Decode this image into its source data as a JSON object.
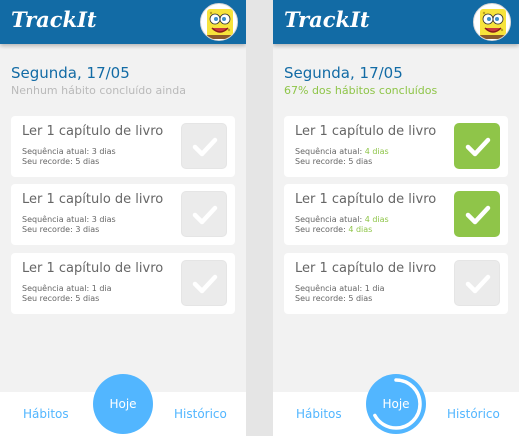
{
  "app": {
    "logo": "TrackIt",
    "avatar_icon": "spongebob-avatar"
  },
  "colors": {
    "header": "#126BA5",
    "accent": "#52B6FF",
    "done": "#8FC549",
    "pending": "#EBEBEB"
  },
  "screens": [
    {
      "date": "Segunda, 17/05",
      "subtitle": "Nenhum hábito concluído ainda",
      "progress": 0,
      "habits": [
        {
          "title": "Ler 1 capítulo de livro",
          "sequence_label": "Sequência atual:",
          "sequence_value": "3 dias",
          "record_label": "Seu recorde:",
          "record_value": "5 dias",
          "done": false
        },
        {
          "title": "Ler 1 capítulo de livro",
          "sequence_label": "Sequência atual:",
          "sequence_value": "3 dias",
          "record_label": "Seu recorde:",
          "record_value": "3 dias",
          "done": false
        },
        {
          "title": "Ler 1 capítulo de livro",
          "sequence_label": "Sequência atual:",
          "sequence_value": "1 dia",
          "record_label": "Seu recorde:",
          "record_value": "5 dias",
          "done": false
        }
      ],
      "nav": {
        "habits": "Hábitos",
        "today": "Hoje",
        "history": "Histórico"
      }
    },
    {
      "date": "Segunda, 17/05",
      "subtitle": "67% dos hábitos concluídos",
      "progress": 0.67,
      "habits": [
        {
          "title": "Ler 1 capítulo de livro",
          "sequence_label": "Sequência atual:",
          "sequence_value": "4 dias",
          "record_label": "Seu recorde:",
          "record_value": "5 dias",
          "done": true
        },
        {
          "title": "Ler 1 capítulo de livro",
          "sequence_label": "Sequência atual:",
          "sequence_value": "4 dias",
          "record_label": "Seu recorde:",
          "record_value": "4 dias",
          "done": true
        },
        {
          "title": "Ler 1 capítulo de livro",
          "sequence_label": "Sequência atual:",
          "sequence_value": "1 dia",
          "record_label": "Seu recorde:",
          "record_value": "5 dias",
          "done": false
        }
      ],
      "nav": {
        "habits": "Hábitos",
        "today": "Hoje",
        "history": "Histórico"
      }
    }
  ]
}
